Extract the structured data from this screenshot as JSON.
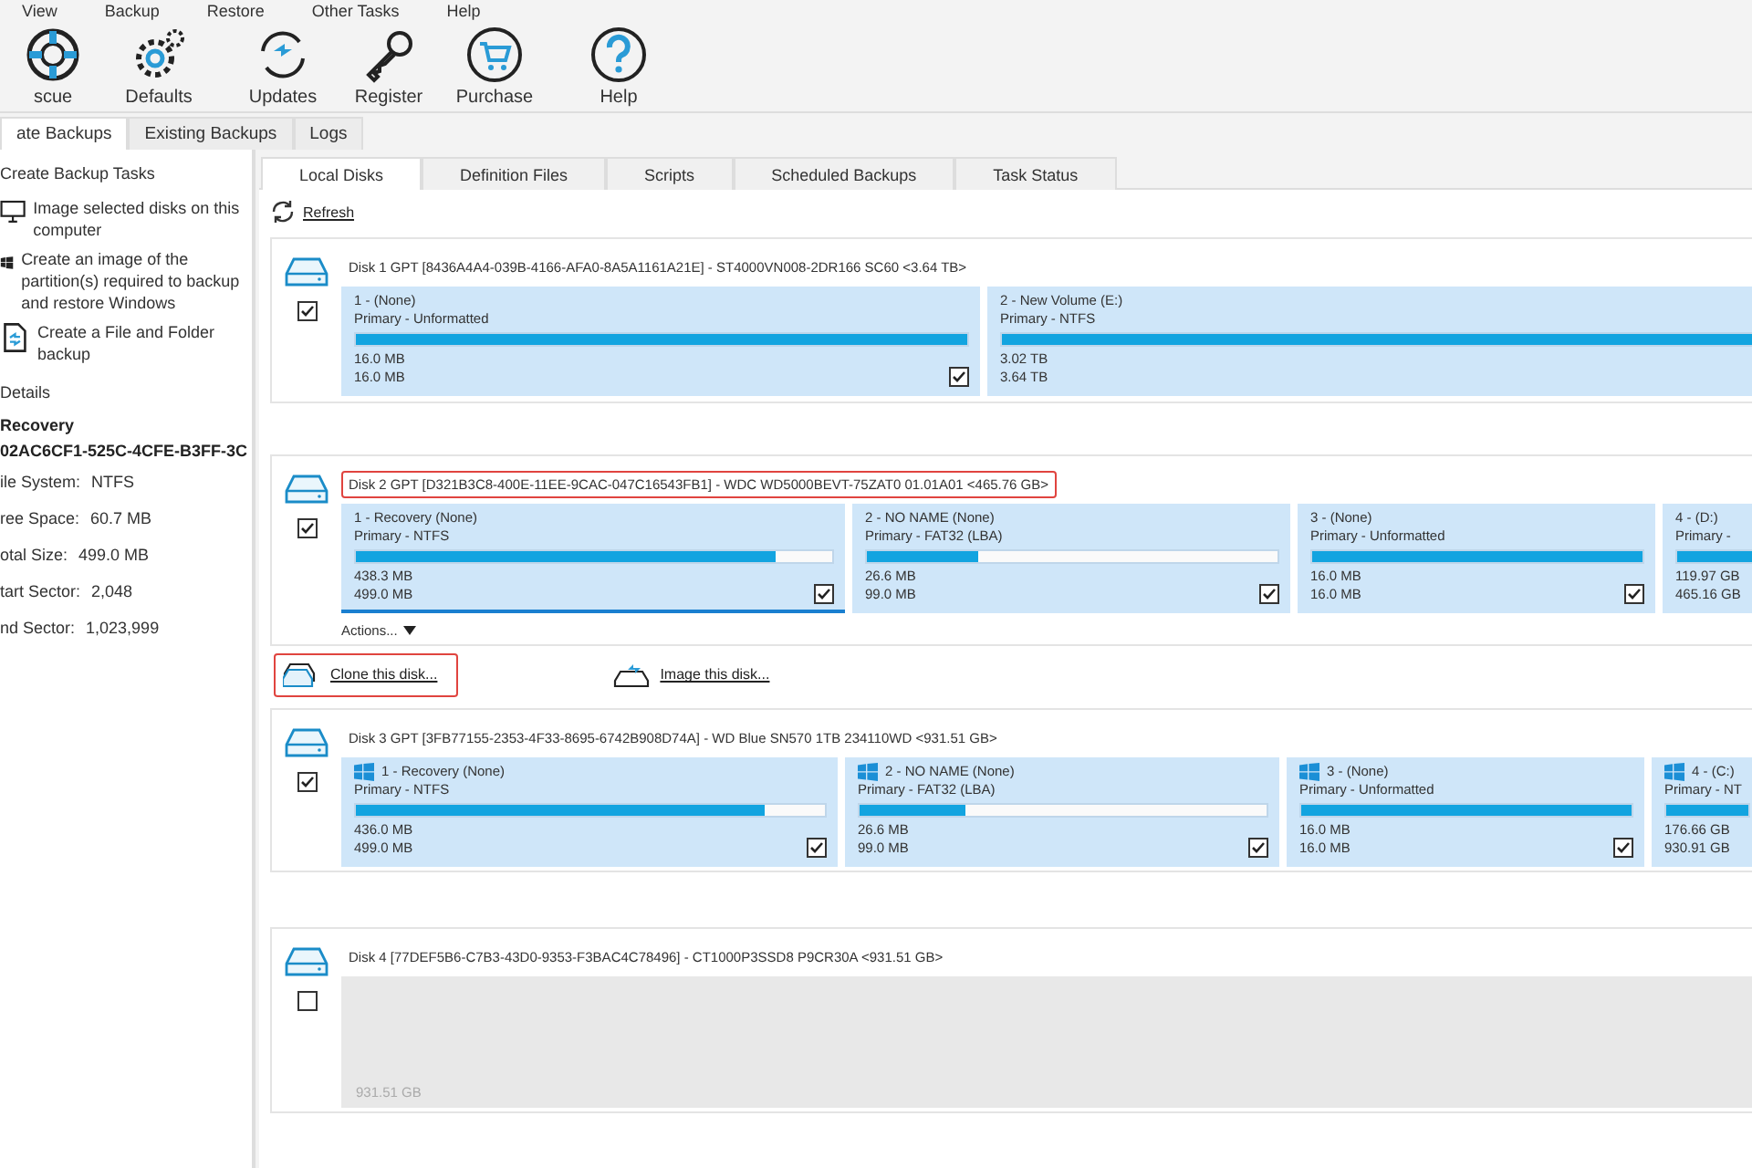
{
  "menu": [
    "View",
    "Backup",
    "Restore",
    "Other Tasks",
    "Help"
  ],
  "toolbar": [
    {
      "label": "scue",
      "kind": "rescue"
    },
    {
      "label": "Defaults",
      "kind": "defaults"
    },
    {
      "label": "Updates",
      "kind": "updates"
    },
    {
      "label": "Register",
      "kind": "register"
    },
    {
      "label": "Purchase",
      "kind": "purchase"
    },
    {
      "label": "Help",
      "kind": "help"
    }
  ],
  "main_tabs": [
    {
      "label": "ate Backups",
      "selected": true
    },
    {
      "label": "Existing Backups",
      "selected": false
    },
    {
      "label": "Logs",
      "selected": false
    }
  ],
  "sidebar": {
    "tasks_heading": "Create Backup Tasks",
    "tasks": [
      {
        "kind": "monitor",
        "label": "Image selected disks on this computer"
      },
      {
        "kind": "windows",
        "label": "Create an image of the partition(s) required to backup and restore Windows"
      },
      {
        "kind": "file",
        "label": "Create a File and Folder backup"
      }
    ],
    "details_heading": "Details",
    "details_title": "Recovery",
    "details_id": "02AC6CF1-525C-4CFE-B3FF-3C",
    "details": [
      {
        "label": "ile System:",
        "value": "NTFS"
      },
      {
        "label": "ree Space:",
        "value": "60.7 MB"
      },
      {
        "label": "otal Size:",
        "value": "499.0 MB"
      },
      {
        "label": "tart Sector:",
        "value": "2,048"
      },
      {
        "label": "nd Sector:",
        "value": "1,023,999"
      }
    ]
  },
  "content_tabs": [
    {
      "label": "Local Disks",
      "selected": true
    },
    {
      "label": "Definition Files",
      "selected": false
    },
    {
      "label": "Scripts",
      "selected": false
    },
    {
      "label": "Scheduled Backups",
      "selected": false
    },
    {
      "label": "Task Status",
      "selected": false
    }
  ],
  "refresh": "Refresh",
  "disks": [
    {
      "title": "Disk 1 GPT [8436A4A4-039B-4166-AFA0-8A5A1161A21E] - ST4000VN008-2DR166 SC60  <3.64 TB>",
      "highlighted": false,
      "checked": true,
      "partitions": [
        {
          "kind": "partition",
          "name": "1 -  (None)",
          "type": "Primary - Unformatted",
          "used": "16.0 MB",
          "total": "16.0 MB",
          "level": 1,
          "checked": true,
          "selected": false,
          "windows": false
        },
        {
          "kind": "partition",
          "name": "2 - New Volume (E:)",
          "type": "Primary - NTFS",
          "used": "3.02 TB",
          "total": "3.64 TB",
          "level": 1,
          "selected": false,
          "windows": false
        }
      ]
    },
    {
      "title": "Disk 2 GPT [D321B3C8-400E-11EE-9CAC-047C16543FB1] - WDC WD5000BEVT-75ZAT0 01.01A01  <465.76 GB>",
      "highlighted": true,
      "checked": true,
      "actions": "Actions...",
      "links": [
        {
          "kind": "clone",
          "label": "Clone this disk...",
          "highlighted": true
        },
        {
          "kind": "image",
          "label": "Image this disk...",
          "highlighted": false
        }
      ],
      "partitions": [
        {
          "kind": "partition",
          "name": "1 - Recovery (None)",
          "type": "Primary - NTFS",
          "used": "438.3 MB",
          "total": "499.0 MB",
          "level": 0.88,
          "checked": true,
          "selected": true,
          "windows": false
        },
        {
          "kind": "partition",
          "name": "2 - NO NAME (None)",
          "type": "Primary - FAT32 (LBA)",
          "used": "26.6 MB",
          "total": "99.0 MB",
          "level": 0.27,
          "checked": true,
          "selected": false,
          "windows": false
        },
        {
          "kind": "partition",
          "name": "3 -  (None)",
          "type": "Primary - Unformatted",
          "used": "16.0 MB",
          "total": "16.0 MB",
          "level": 1,
          "checked": true,
          "selected": false,
          "windows": false
        },
        {
          "kind": "partition",
          "name": "4 -  (D:)",
          "type": "Primary -",
          "used": "119.97 GB",
          "total": "465.16 GB",
          "level": 1,
          "selected": false,
          "windows": false
        }
      ]
    },
    {
      "title": "Disk 3 GPT [3FB77155-2353-4F33-8695-6742B908D74A] - WD Blue SN570 1TB 234110WD  <931.51 GB>",
      "highlighted": false,
      "checked": true,
      "partitions": [
        {
          "kind": "partition",
          "name": "1 - Recovery (None)",
          "type": "Primary - NTFS",
          "used": "436.0 MB",
          "total": "499.0 MB",
          "level": 0.87,
          "checked": true,
          "selected": false,
          "windows": true
        },
        {
          "kind": "partition",
          "name": "2 - NO NAME (None)",
          "type": "Primary - FAT32 (LBA)",
          "used": "26.6 MB",
          "total": "99.0 MB",
          "level": 0.26,
          "checked": true,
          "selected": false,
          "windows": true
        },
        {
          "kind": "partition",
          "name": "3 -  (None)",
          "type": "Primary - Unformatted",
          "used": "16.0 MB",
          "total": "16.0 MB",
          "level": 1,
          "checked": true,
          "selected": false,
          "windows": true
        },
        {
          "kind": "partition",
          "name": "4 -  (C:)",
          "type": "Primary - NT",
          "used": "176.66 GB",
          "total": "930.91 GB",
          "level": 1,
          "selected": false,
          "windows": true
        }
      ]
    },
    {
      "title": "Disk 4 [77DEF5B6-C7B3-43D0-9353-F3BAC4C78496] - CT1000P3SSD8 P9CR30A  <931.51 GB>",
      "highlighted": false,
      "checked": false,
      "partitions": [
        {
          "kind": "empty",
          "total": "931.51 GB"
        }
      ]
    }
  ]
}
